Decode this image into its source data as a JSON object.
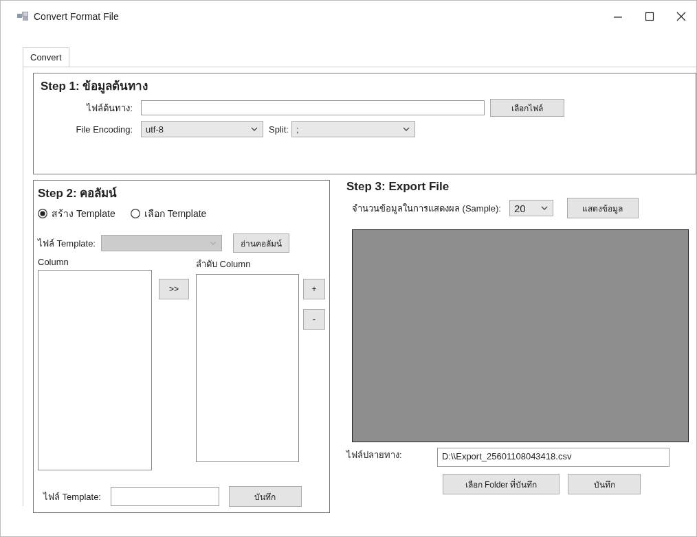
{
  "window": {
    "title": "Convert Format File"
  },
  "tabs": [
    {
      "label": "Convert",
      "selected": true
    }
  ],
  "step1": {
    "title": "Step 1: ข้อมูลต้นทาง",
    "source_label": "ไฟล์ต้นทาง:",
    "source_button": "เลือกไฟล์",
    "encoding_label": "File Encoding:",
    "encoding_value": "utf-8",
    "split_label": "Split:",
    "split_value": ";"
  },
  "step2": {
    "title": "Step 2: คอลัมน์",
    "radios": [
      {
        "label": "สร้าง Template",
        "selected": true
      },
      {
        "label": "เลือก Template",
        "selected": false
      }
    ],
    "template_label": "ไฟล์ Template:",
    "template_disabled": true,
    "read_button": "อ่านคอลัมน์",
    "column_label": "Column",
    "order_label": "ลำดับ Column",
    "move_button": ">>",
    "add_button": "+",
    "remove_button": "-",
    "save_label": "ไฟล์ Template:",
    "save_button": "บันทึก"
  },
  "step3": {
    "title": "Step 3: Export File",
    "sample_label": "จำนวนข้อมูลในการแสดงผล (Sample):",
    "sample_value": "20",
    "show_button": "แสดงข้อมูล",
    "dest_label": "ไฟล์ปลายทาง:",
    "dest_value": "D:\\\\Export_25601108043418.csv",
    "folder_button": "เลือก Folder ที่บันทึก",
    "save_button": "บันทึก"
  }
}
